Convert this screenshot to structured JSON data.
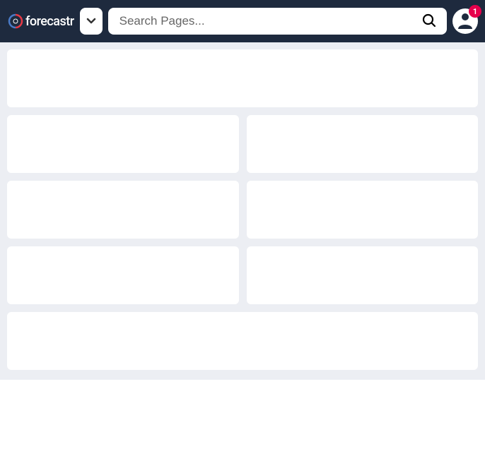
{
  "header": {
    "logo_text": "forecastr",
    "search_placeholder": "Search Pages...",
    "notification_count": "1"
  },
  "colors": {
    "header_bg": "#1e2a3e",
    "content_bg": "#eceef3",
    "badge_bg": "#e6004c",
    "logo_accent_red": "#e63946",
    "logo_accent_blue": "#4a7bc8"
  }
}
